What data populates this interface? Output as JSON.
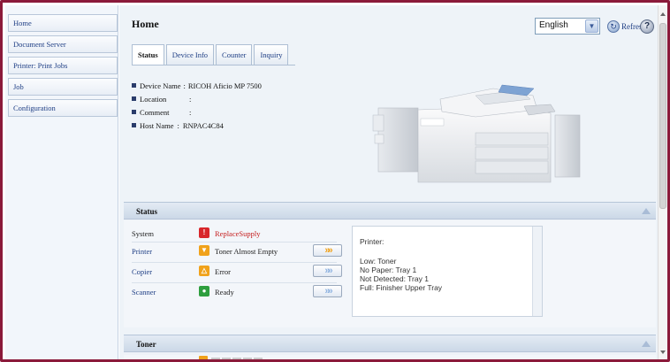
{
  "sidebar": {
    "items": [
      {
        "label": "Home"
      },
      {
        "label": "Document Server"
      },
      {
        "label": "Printer: Print Jobs"
      },
      {
        "label": "Job"
      },
      {
        "label": "Configuration"
      }
    ]
  },
  "header": {
    "title": "Home",
    "language": "English",
    "refresh_label": "Refresh",
    "help_glyph": "?"
  },
  "tabs": [
    {
      "label": "Status",
      "active": true
    },
    {
      "label": "Device Info"
    },
    {
      "label": "Counter"
    },
    {
      "label": "Inquiry"
    }
  ],
  "device_info": [
    {
      "label": "Device Name",
      "value": "RICOH Aficio MP 7500"
    },
    {
      "label": "Location",
      "value": ""
    },
    {
      "label": "Comment",
      "value": ""
    },
    {
      "label": "Host Name",
      "value": "RNPAC4C84"
    }
  ],
  "status_section": {
    "title": "Status",
    "rows": [
      {
        "name": "System",
        "status": "ReplaceSupply",
        "icon": "replace-supply-icon",
        "color": "#d8262b"
      },
      {
        "name": "Printer",
        "status": "Toner Almost Empty",
        "icon": "toner-warning-icon",
        "color": "#f0a21b",
        "has_detail_button": true
      },
      {
        "name": "Copier",
        "status": "Error",
        "icon": "error-icon",
        "color": "#f0a21b",
        "has_detail_button": true
      },
      {
        "name": "Scanner",
        "status": "Ready",
        "icon": "ready-icon",
        "color": "#2e9e3e",
        "has_detail_button": true
      }
    ],
    "detail": {
      "heading": "Printer:",
      "lines": [
        "Low: Toner",
        "No Paper: Tray 1",
        "Not Detected: Tray 1",
        "Full: Finisher Upper Tray"
      ]
    }
  },
  "toner_section": {
    "title": "Toner"
  },
  "colors": {
    "frame": "#8b1a3a",
    "link": "#1f3f85",
    "section_bar": "#cbd8e7",
    "error_red": "#c51d1d"
  }
}
